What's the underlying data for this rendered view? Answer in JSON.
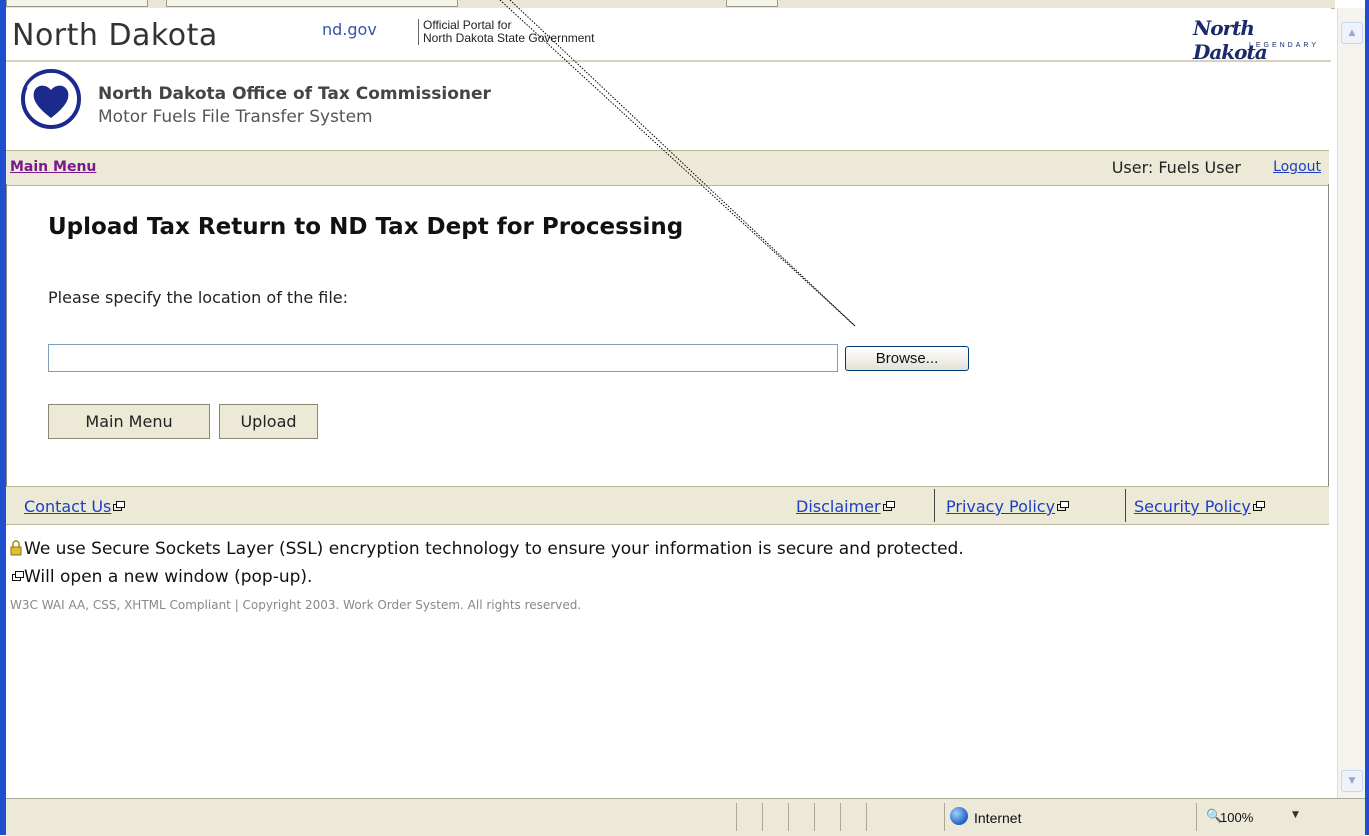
{
  "header": {
    "state_name": "North Dakota",
    "portal_domain": "nd.gov",
    "portal_line1": "Official Portal for",
    "portal_line2": "North Dakota State Government",
    "logo_script": "North Dakota",
    "logo_tagline": "LEGENDARY"
  },
  "office": {
    "name": "North Dakota Office of Tax Commissioner",
    "subtitle": "Motor Fuels File Transfer System"
  },
  "nav": {
    "main_menu": "Main Menu",
    "user": "User: Fuels User",
    "logout": "Logout"
  },
  "main": {
    "heading": "Upload Tax Return to ND Tax Dept for Processing",
    "prompt": "Please specify the location of the file:",
    "file_value": "",
    "browse_label": "Browse...",
    "main_menu_button": "Main Menu",
    "upload_button": "Upload"
  },
  "footer": {
    "contact": "Contact Us",
    "disclaimer": "Disclaimer",
    "privacy": "Privacy Policy",
    "security": "Security Policy",
    "ssl_note": "We use Secure Sockets Layer (SSL) encryption technology to ensure your information is secure and protected.",
    "popup_note": "Will open a new window (pop-up).",
    "copyright": "W3C WAI AA, CSS, XHTML Compliant | Copyright 2003. Work Order System. All rights reserved."
  },
  "statusbar": {
    "zone": "Internet",
    "zoom": "100%"
  },
  "colors": {
    "nav_bg": "#ece9d6",
    "link": "#1a3fc4",
    "visited_link": "#7a1a8a",
    "heart": "#1b2a8c"
  },
  "icons": [
    "lock-icon",
    "popup-window-icon",
    "globe-icon",
    "zoom-icon",
    "heart-logo-icon"
  ]
}
